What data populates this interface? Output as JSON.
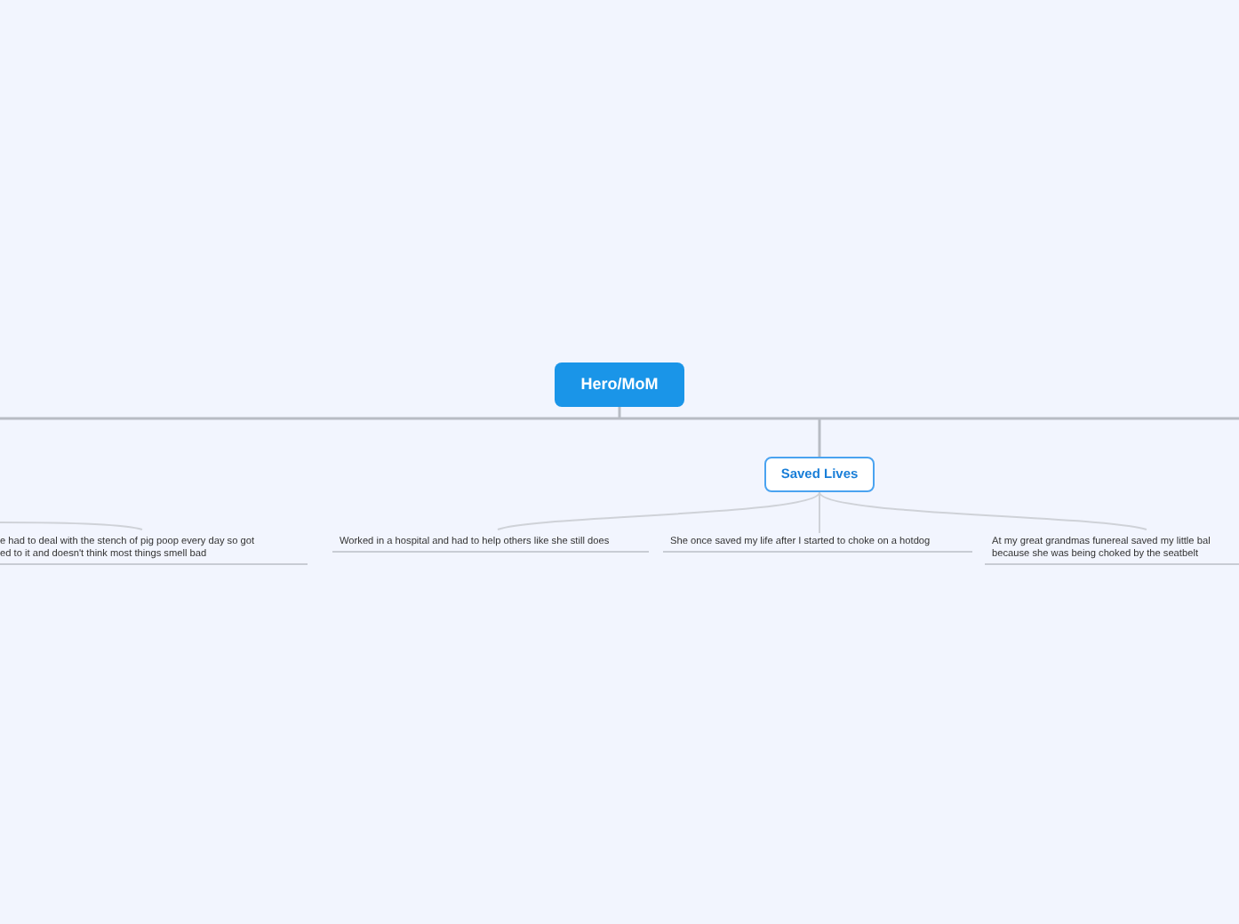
{
  "root": {
    "label": "Hero/MoM"
  },
  "offscreen_branch_children": [
    {
      "lines": [
        "e had to deal with the stench of pig poop every day so got",
        "ed to it and doesn't think most things smell bad"
      ]
    }
  ],
  "branches": [
    {
      "label": "Saved Lives",
      "children": [
        {
          "lines": [
            "Worked in a hospital and had to help others like she still does"
          ]
        },
        {
          "lines": [
            "She once saved my life after I started to choke on a hotdog"
          ]
        },
        {
          "lines": [
            "At my great grandmas funereal saved my little bal",
            "because she was being choked by the seatbelt"
          ]
        }
      ]
    }
  ]
}
